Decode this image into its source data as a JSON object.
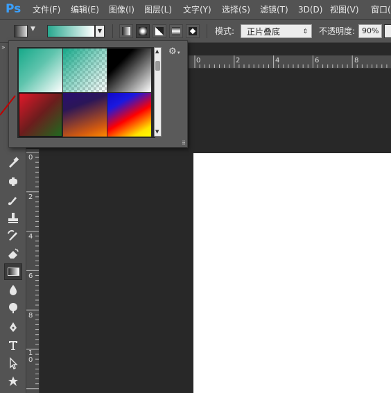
{
  "app": {
    "logo": "Ps",
    "brand_color": "#3aa0ff"
  },
  "menu": [
    {
      "label": "文件(F)"
    },
    {
      "label": "编辑(E)"
    },
    {
      "label": "图像(I)"
    },
    {
      "label": "图层(L)"
    },
    {
      "label": "文字(Y)"
    },
    {
      "label": "选择(S)"
    },
    {
      "label": "滤镜(T)"
    },
    {
      "label": "3D(D)"
    },
    {
      "label": "视图(V)"
    },
    {
      "label": "窗口("
    }
  ],
  "options": {
    "tool_preset_icon": "gradient-tool-icon",
    "gradient_current": {
      "from": "#28a88f",
      "to": "#ffffff"
    },
    "gradient_types": [
      "linear",
      "radial",
      "angle",
      "reflected",
      "diamond"
    ],
    "selected_type": "radial",
    "mode_label": "模式:",
    "mode_value": "正片叠底",
    "opacity_label": "不透明度:",
    "opacity_value": "90%"
  },
  "gradient_picker": {
    "gear_icon": "gear-icon",
    "presets": [
      {
        "name": "foreground-to-background",
        "css": "linear-gradient(135deg,#16a889 0%,#5fc4ad 45%,#ffffff 100%)"
      },
      {
        "name": "foreground-to-transparent",
        "css": "linear-gradient(135deg,#16a889 0%,rgba(22,168,137,0.5) 45%,rgba(255,255,255,0) 100%)"
      },
      {
        "name": "black-white",
        "css": "linear-gradient(135deg,#000000 0%,#000000 30%,#ffffff 100%)"
      },
      {
        "name": "red-green",
        "css": "linear-gradient(135deg,#e2182a 0%,#6b1d1d 50%,#1f6a1f 100%)"
      },
      {
        "name": "violet-orange",
        "css": "linear-gradient(160deg,#2a0f70 0%,#2b1658 30%,#d25a10 80%,#ff8a00 100%)"
      },
      {
        "name": "blue-red-yellow",
        "css": "linear-gradient(150deg,#1008c8 0%,#1a18e0 25%,#ff0000 55%,#ffe400 85%,#ffff00 100%)"
      }
    ]
  },
  "rulers": {
    "horizontal_labels": [
      "0",
      "2",
      "4",
      "6",
      "8"
    ],
    "vertical_labels": [
      "0",
      "2",
      "4",
      "6",
      "8",
      "1 0"
    ]
  },
  "tools": [
    "eyedropper-icon",
    "healing-brush-icon",
    "brush-icon",
    "clone-stamp-icon",
    "history-brush-icon",
    "eraser-icon",
    "gradient-tool-icon",
    "blur-icon",
    "dodge-icon",
    "pen-tool-icon",
    "type-tool-icon",
    "path-selection-icon",
    "custom-shape-icon"
  ],
  "colors": {
    "menubar_bg": "#535353",
    "workspace_bg": "#282828",
    "canvas_bg": "#ffffff"
  }
}
